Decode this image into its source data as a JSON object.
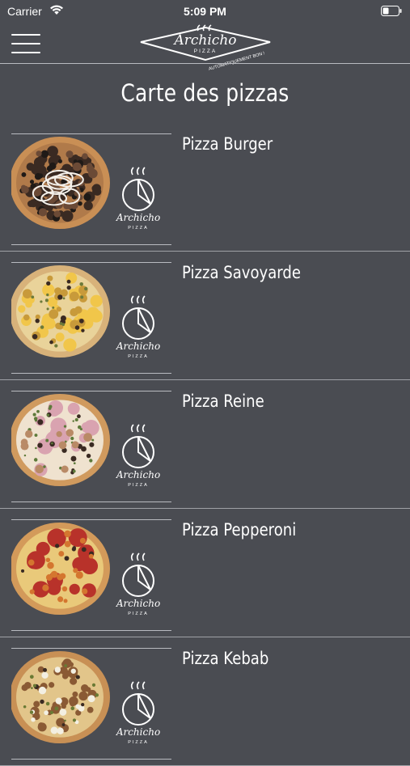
{
  "status": {
    "carrier": "Carrier",
    "time": "5:09 PM"
  },
  "header": {
    "logo_name": "Archicho",
    "logo_sub": "PIZZA",
    "logo_tagline": "AUTOMATIQUEMENT BON !",
    "menu_icon": "hamburger-menu-icon"
  },
  "page_title": "Carte des pizzas",
  "pizzas": [
    {
      "name": "Pizza Burger",
      "style": "burger"
    },
    {
      "name": "Pizza Savoyarde",
      "style": "savoyarde"
    },
    {
      "name": "Pizza Reine",
      "style": "reine"
    },
    {
      "name": "Pizza Pepperoni",
      "style": "pepperoni"
    },
    {
      "name": "Pizza Kebab",
      "style": "kebab"
    }
  ],
  "thumb_brand": {
    "name": "Archicho",
    "sub": "PIZZA"
  },
  "colors": {
    "background": "#4a4c52",
    "text": "#ffffff",
    "divider": "#9fa1a6"
  }
}
